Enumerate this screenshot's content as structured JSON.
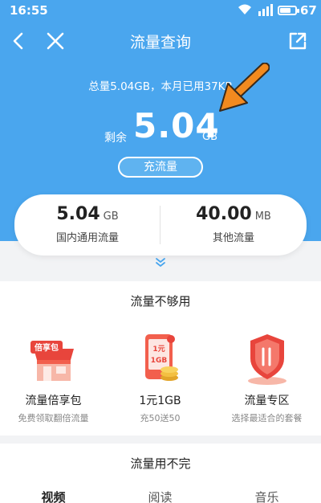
{
  "status_bar": {
    "time": "16:55",
    "battery": "67"
  },
  "nav": {
    "title": "流量查询"
  },
  "summary": {
    "text": "总量5.04GB，本月已用37KB"
  },
  "remaining": {
    "label": "剩余",
    "value": "5.04",
    "unit": "GB"
  },
  "recharge_button": "充流量",
  "stats": [
    {
      "value": "5.04",
      "unit": "GB",
      "label": "国内通用流量"
    },
    {
      "value": "40.00",
      "unit": "MB",
      "label": "其他流量"
    }
  ],
  "section_not_enough": {
    "title": "流量不够用",
    "items": [
      {
        "title": "流量倍享包",
        "subtitle": "免费领取翻倍流量",
        "badge": "倍享包"
      },
      {
        "title": "1元1GB",
        "subtitle": "充50送50",
        "badge_line1": "1元",
        "badge_line2": "1GB"
      },
      {
        "title": "流量专区",
        "subtitle": "选择最适合的套餐"
      }
    ]
  },
  "section_too_much": {
    "title": "流量用不完",
    "tabs": [
      "视频",
      "阅读",
      "音乐"
    ]
  },
  "colors": {
    "header": "#4aa6ee",
    "arrow": "#f28a1f",
    "accent_red": "#e8453c"
  }
}
